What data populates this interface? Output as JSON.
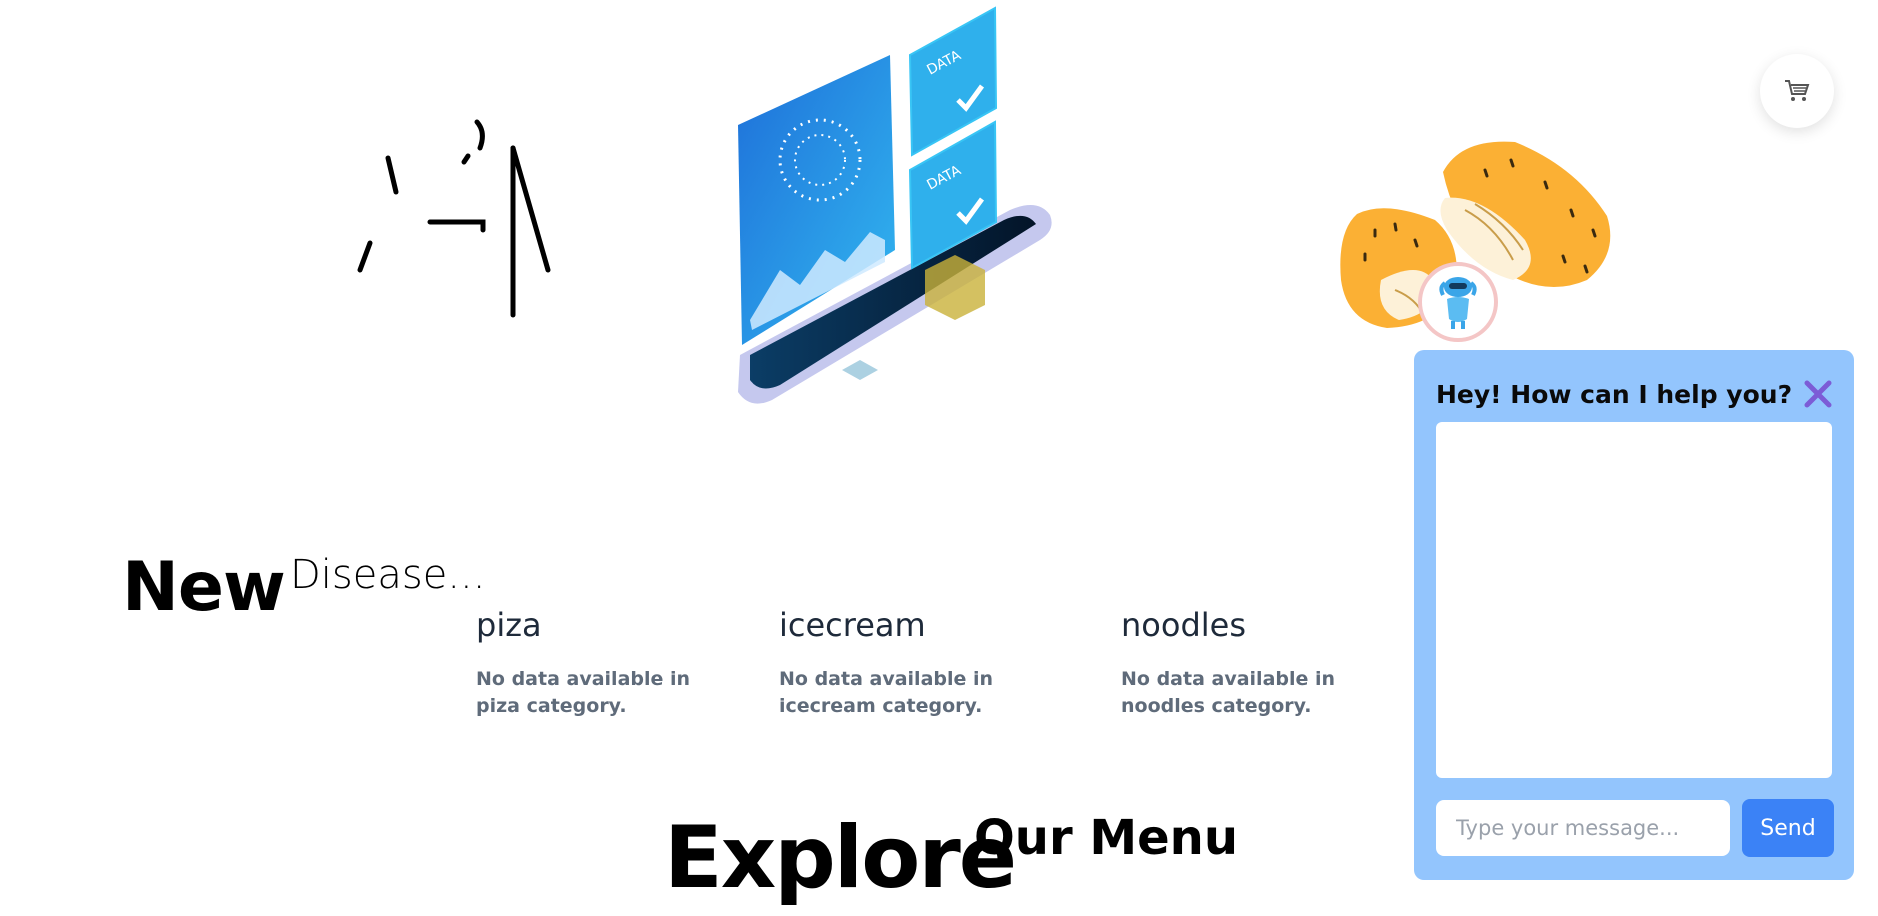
{
  "hero": {
    "new_label": "New",
    "disease_label": "Disease..."
  },
  "categories": [
    {
      "title": "piza",
      "empty_message": "No data available in piza category."
    },
    {
      "title": "icecream",
      "empty_message": "No data available in icecream category."
    },
    {
      "title": "noodles",
      "empty_message": "No data available in noodles category."
    }
  ],
  "menu_section": {
    "explore_label": "Explore",
    "our_menu_label": "Our Menu"
  },
  "chat": {
    "title": "Hey! How can I help you?",
    "input_placeholder": "Type your message...",
    "input_value": "",
    "send_label": "Send"
  },
  "illustration": {
    "data_label": "DATA"
  },
  "icons": {
    "cart": "cart-icon",
    "close": "close-icon",
    "bot": "robot-icon"
  },
  "colors": {
    "chat_panel_bg": "#93c5fd",
    "send_button": "#3b82f6",
    "close_icon": "#7c5cd6",
    "food_yellow": "#fbb034"
  }
}
